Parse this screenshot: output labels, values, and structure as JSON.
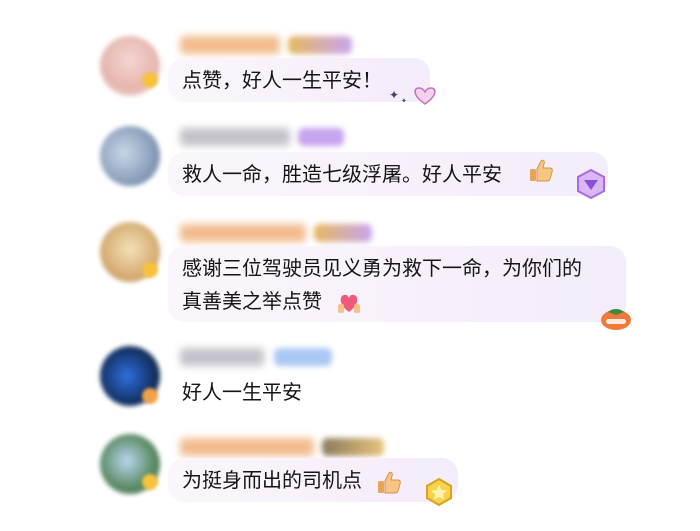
{
  "comments": [
    {
      "text_lines": [
        "点赞，好人一生平安！"
      ]
    },
    {
      "text_lines": [
        "救人一命，胜造七级浮屠。好人平安"
      ]
    },
    {
      "text_lines": [
        "感谢三位驾驶员见义勇为救下一命，为你们的",
        "真善美之举点赞"
      ]
    },
    {
      "text_lines": [
        "好人一生平安"
      ]
    },
    {
      "text_lines": [
        "为挺身而出的司机点"
      ]
    }
  ],
  "colors": {
    "bubble": "#f7f0fb",
    "nickname_orange": "#f0b07a",
    "nickname_gray": "#b8b8c0",
    "vip_purple": "#c7a4ef",
    "badge_gold": "#f6c23d"
  }
}
